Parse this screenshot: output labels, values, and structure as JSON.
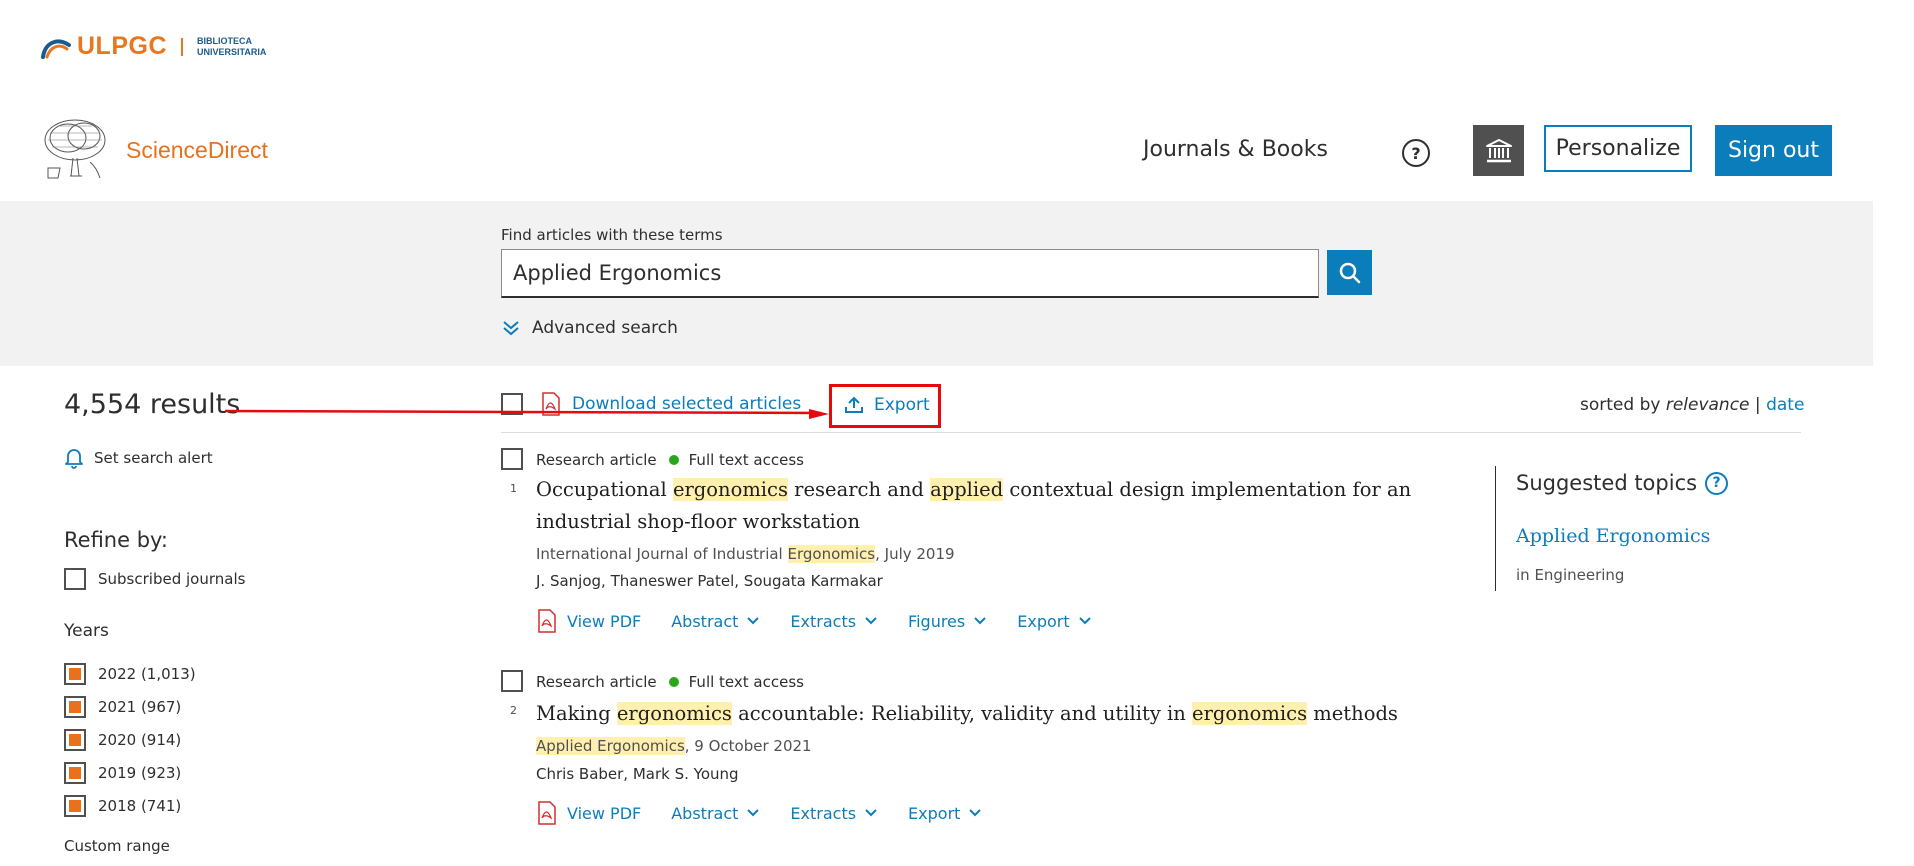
{
  "header": {
    "ulpgc_name": "ULPGC",
    "library_line1": "BIBLIOTECA",
    "library_line2": "UNIVERSITARIA",
    "brand": "ScienceDirect",
    "nav_journals": "Journals & Books",
    "help": "?",
    "personalize": "Personalize",
    "sign_out": "Sign out"
  },
  "search": {
    "label": "Find articles with these terms",
    "value": "Applied Ergonomics",
    "advanced": "Advanced search"
  },
  "sidebar": {
    "results": "4,554 results",
    "alert": "Set search alert",
    "refine": "Refine by:",
    "subscribed": "Subscribed journals",
    "years_heading": "Years",
    "years": [
      {
        "label": "2022 (1,013)",
        "checked": true
      },
      {
        "label": "2021 (967)",
        "checked": true
      },
      {
        "label": "2020 (914)",
        "checked": true
      },
      {
        "label": "2019 (923)",
        "checked": true
      },
      {
        "label": "2018 (741)",
        "checked": true
      }
    ],
    "custom_range": "Custom range"
  },
  "toolbar": {
    "download": "Download selected articles",
    "export": "Export",
    "sorted_by": "sorted by ",
    "relevance": "relevance",
    "separator": " | ",
    "date": "date"
  },
  "results": [
    {
      "num": "1",
      "type": "Research article",
      "access": "Full text access",
      "title_parts": [
        "Occupational ",
        "ergonomics",
        " research and ",
        "applied",
        " contextual design implementation for an industrial shop-floor workstation"
      ],
      "journal_parts": [
        "International Journal of Industrial ",
        "Ergonomics",
        ", July 2019"
      ],
      "authors": "J. Sanjog, Thaneswer Patel, Sougata Karmakar",
      "actions": {
        "pdf": "View PDF",
        "abstract": "Abstract",
        "extracts": "Extracts",
        "figures": "Figures",
        "export": "Export"
      }
    },
    {
      "num": "2",
      "type": "Research article",
      "access": "Full text access",
      "title_parts": [
        "Making ",
        "ergonomics",
        " accountable: Reliability, validity and utility in ",
        "ergonomics",
        " methods"
      ],
      "journal_parts": [
        "Applied Ergonomics",
        ", 9 October 2021"
      ],
      "authors": "Chris Baber, Mark S. Young",
      "actions": {
        "pdf": "View PDF",
        "abstract": "Abstract",
        "extracts": "Extracts",
        "export": "Export"
      }
    }
  ],
  "topics": {
    "heading": "Suggested topics",
    "help": "?",
    "link": "Applied Ergonomics",
    "sub": "in Engineering"
  },
  "colors": {
    "accent_blue": "#0c7dbb",
    "brand_orange": "#e9711c",
    "annotation_red": "#e50b0b",
    "highlight": "#fff0b0",
    "access_green": "#29a61b"
  }
}
